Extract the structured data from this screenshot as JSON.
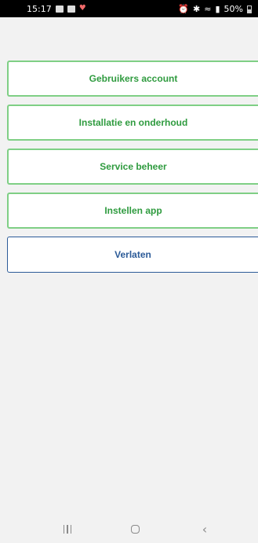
{
  "status_bar": {
    "time": "15:17",
    "battery": "50%"
  },
  "menu": {
    "items": [
      {
        "label": "Gebruikers account"
      },
      {
        "label": "Installatie en onderhoud"
      },
      {
        "label": "Service beheer"
      },
      {
        "label": "Instellen app"
      },
      {
        "label": "Verlaten"
      }
    ]
  },
  "icons": {
    "status_left": [
      "photo-icon",
      "gallery-icon",
      "heart-icon"
    ],
    "status_right": [
      "alarm-icon",
      "bluetooth-icon",
      "wifi-icon",
      "signal-icon",
      "battery-icon"
    ],
    "nav": [
      "recent-apps-icon",
      "home-icon",
      "back-icon"
    ]
  },
  "colors": {
    "accent_green": "#2f9b3f",
    "border_green": "#7fcf85",
    "exit_blue": "#2c5b98",
    "background": "#f2f2f2"
  }
}
